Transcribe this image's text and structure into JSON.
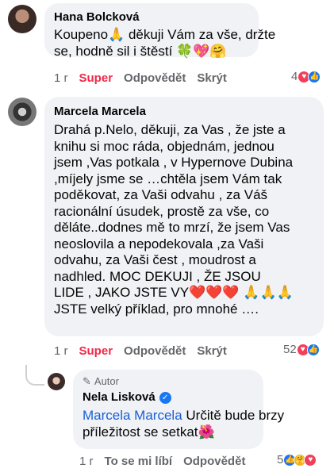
{
  "comments": [
    {
      "author": "Hana Bolcková",
      "lines": [
        "Koupeno🙏 děkuji Vám za vše, držte",
        "se, hodně sil i štěstí 🍀💖🤗"
      ],
      "time": "1 r",
      "reaction_label": "Super",
      "reply_label": "Odpovědět",
      "hide_label": "Skrýt",
      "reaction_count": "4"
    },
    {
      "author": "Marcela Marcela",
      "lines": [
        "Drahá   p.Nelo, děkuji,  za Vas , že jste a",
        "knihu si  moc ráda,  objednám, jednou",
        "jsem ,Vas potkala , v Hypernove Dubina",
        " ,míjely jsme se …chtěla jsem Vám  tak",
        "poděkovat,  za Vaši odvahu , za Váš",
        "racionální úsudek, prostě za vše, co",
        "děláte..dodnes mě to mrzí,  že jsem Vas",
        "neoslovila a nepodekovala ,za Vaši",
        "odvahu, za Vaši čest , moudrost  a",
        "nadhled.  MOC DEKUJI , ŽE JSOU",
        "LIDE , JAKO JSTE VY❤️❤️❤️ 🙏🙏🙏",
        "JSTE velký příklad,  pro mnohé  …."
      ],
      "time": "1 r",
      "reaction_label": "Super",
      "reply_label": "Odpovědět",
      "hide_label": "Skrýt",
      "reaction_count": "52"
    }
  ],
  "reply": {
    "author_badge": "Autor",
    "author": "Nela Lisková",
    "mention": "Marcela Marcela",
    "text_line1": " Určitě bude brzy",
    "text_line2": "příležitost se setkat🌺",
    "time": "1 r",
    "like_label": "To se mi líbí",
    "reply_label": "Odpovědět",
    "reaction_count": "5"
  }
}
